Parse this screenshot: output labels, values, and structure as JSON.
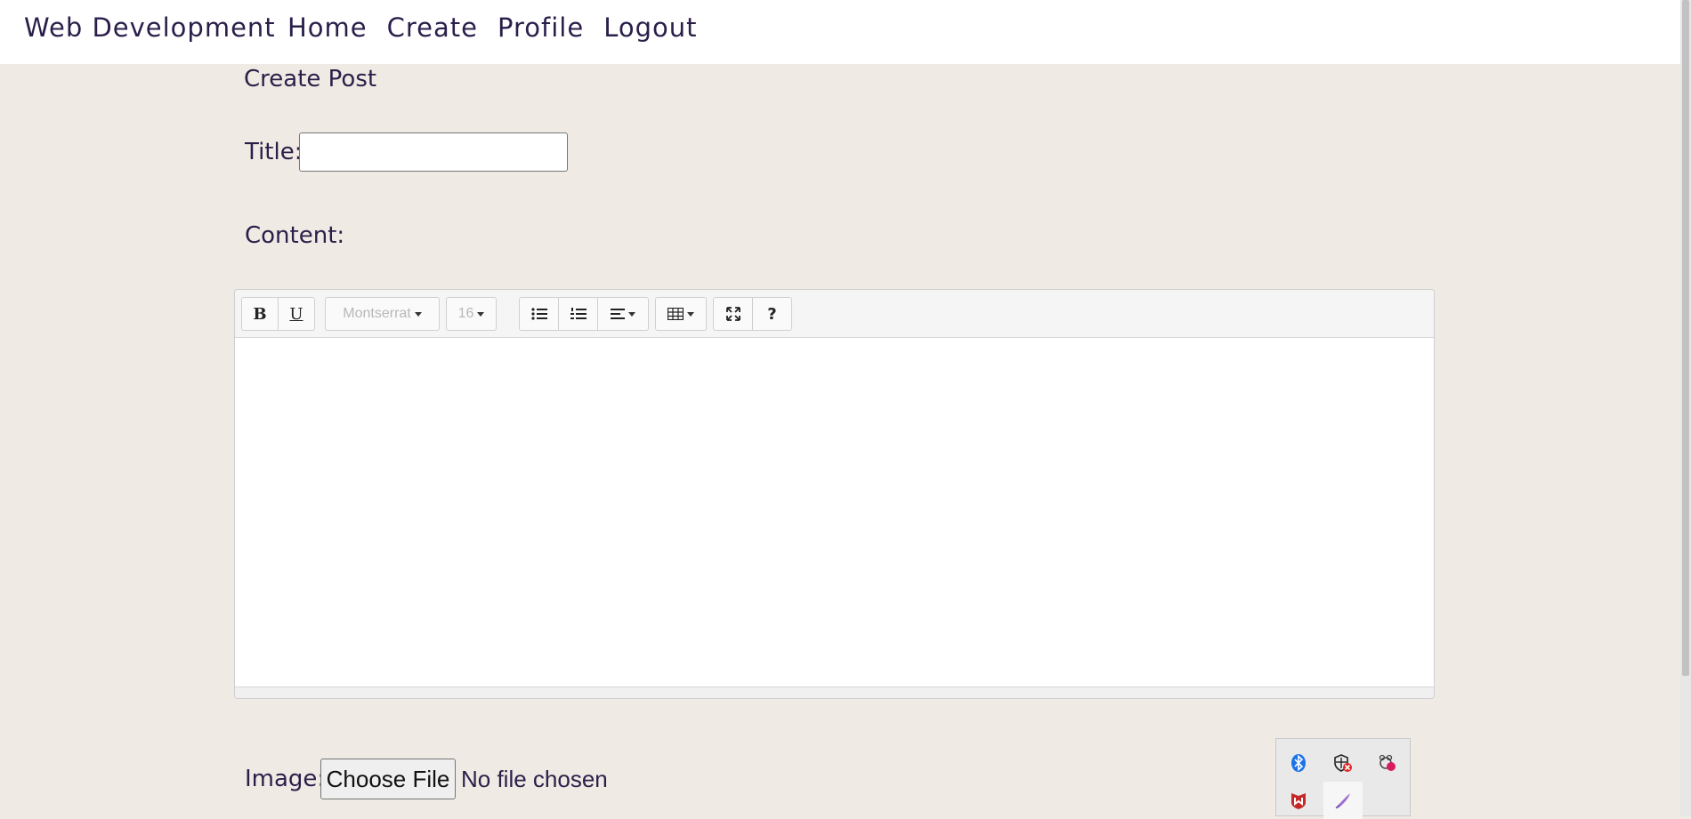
{
  "navbar": {
    "brand": "Web Development",
    "links": [
      "Home",
      "Create",
      "Profile",
      "Logout"
    ]
  },
  "page": {
    "title": "Create Post",
    "title_label": "Title:",
    "title_value": "",
    "content_label": "Content:",
    "image_label": "Image:",
    "choose_file": "Choose File",
    "no_file": "No file chosen"
  },
  "editor": {
    "bold": "B",
    "underline": "U",
    "font_family": "Montserrat",
    "font_size": "16",
    "help": "?"
  },
  "tray": {
    "icons": [
      "bluetooth-icon",
      "shield-alert-icon",
      "network-alert-icon",
      "mcafee-icon",
      "pen-icon"
    ]
  },
  "colors": {
    "background": "#efeae3",
    "text": "#2b1f4a",
    "navbar": "#ffffff"
  }
}
